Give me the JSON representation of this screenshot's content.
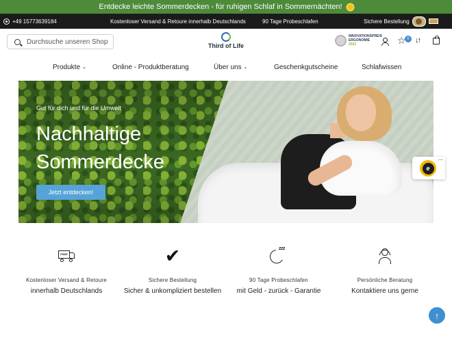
{
  "announcement": {
    "text": "Entdecke leichte Sommerdecken - für ruhigen Schlaf in Sommernächten!"
  },
  "infobar": {
    "phone": "+49 15773639184",
    "shipping": "Kostenloser Versand & Retoure innerhalb Deutschlands",
    "trial": "90 Tage Probeschlafen",
    "secure": "Sichere Bestellung"
  },
  "header": {
    "search_placeholder": "Durchsuche unseren Shop",
    "logo_text": "Third of Life",
    "award_line1": "INNOVATIONSPREIS",
    "award_line2": "ERGONOMIE",
    "award_year": "2022",
    "wishlist_count": "0"
  },
  "nav": {
    "items": [
      {
        "label": "Produkte",
        "dropdown": true
      },
      {
        "label": "Online - Produktberatung",
        "dropdown": false
      },
      {
        "label": "Über uns",
        "dropdown": true
      },
      {
        "label": "Geschenkgutscheine",
        "dropdown": false
      },
      {
        "label": "Schlafwissen",
        "dropdown": false
      }
    ]
  },
  "hero": {
    "kicker": "Gut für dich und für die Umwelt",
    "title_line1": "Nachhaltige",
    "title_line2": "Sommerdecke",
    "button": "Jetzt entdecken!"
  },
  "trust_badge": {
    "letter": "e"
  },
  "features": [
    {
      "icon": "free-shipping-truck-icon",
      "icon_text": "FREE",
      "title": "Kostenloser Versand & Retoure",
      "subtitle": "innerhalb Deutschlands"
    },
    {
      "icon": "checkmark-icon",
      "title": "Sichere Bestellung",
      "subtitle": "Sicher & unkompliziert bestellen"
    },
    {
      "icon": "sleep-moon-icon",
      "icon_text": "zzz",
      "title": "90 Tage Probeschlafen",
      "subtitle": "mit Geld - zurück - Garantie"
    },
    {
      "icon": "customer-service-icon",
      "title": "Persönliche Beratung",
      "subtitle": "Kontaktiere uns gerne"
    }
  ],
  "colors": {
    "announce": "#4d8a3a",
    "infobar": "#1b1b1b",
    "accent": "#56a3d9",
    "badge_blue": "#3d8fd1"
  }
}
